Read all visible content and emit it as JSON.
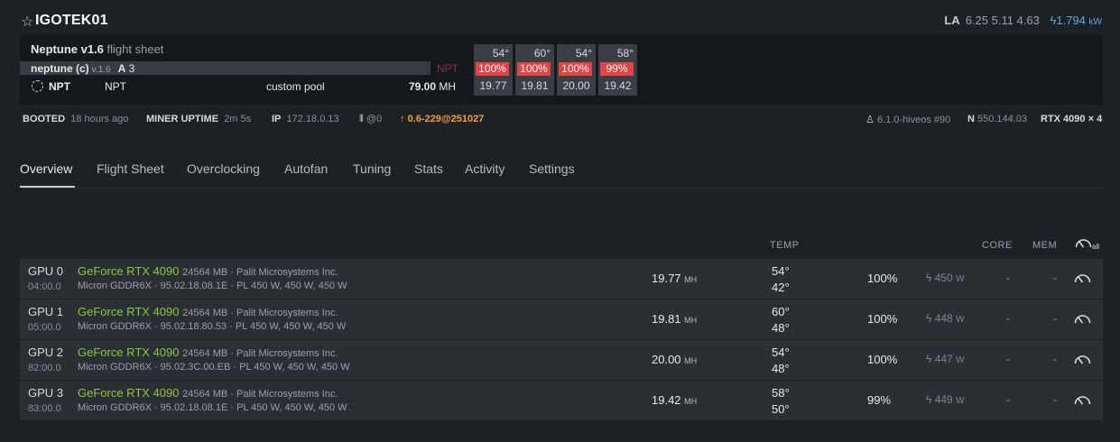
{
  "header": {
    "star_icon": "star-outline-icon",
    "rig_name": "IGOTEK01",
    "la_label": "LA",
    "load_avg": "6.25 5.11 4.63",
    "power_value": "1.794",
    "power_unit": "kW"
  },
  "flight_sheet": {
    "name": "Neptune v1.6",
    "suffix": "flight sheet",
    "miner": "neptune (c)",
    "miner_version": "v.1.6",
    "algo_letter": "A",
    "algo_count": "3",
    "coin_tag": "NPT",
    "coin": "NPT",
    "wallet": "NPT",
    "pool": "custom pool",
    "hashrate": "79.00",
    "hashrate_unit": "MH"
  },
  "gpu_summary": [
    {
      "temp": "54°",
      "fan": "100%",
      "hash": "19.77"
    },
    {
      "temp": "60°",
      "fan": "100%",
      "hash": "19.81"
    },
    {
      "temp": "54°",
      "fan": "100%",
      "hash": "20.00"
    },
    {
      "temp": "58°",
      "fan": "99%",
      "hash": "19.42"
    }
  ],
  "status": {
    "booted_label": "BOOTED",
    "booted_value": "18 hours ago",
    "uptime_label": "MINER UPTIME",
    "uptime_value": "2m 5s",
    "ip_label": "IP",
    "ip_value": "172.18.0.13",
    "network_value": "@0",
    "update_value": "0.6-229@251027",
    "kernel": "6.1.0-hiveos #90",
    "driver_prefix": "N",
    "driver_version": "550.144.03",
    "gpu_model": "RTX 4090",
    "gpu_count": "× 4"
  },
  "tabs": [
    "Overview",
    "Flight Sheet",
    "Overclocking",
    "Autofan",
    "Tuning",
    "Stats",
    "Activity",
    "Settings"
  ],
  "table": {
    "temp_header": "TEMP",
    "core_header": "CORE",
    "mem_header": "MEM",
    "all_label": "all",
    "rows": [
      {
        "idx": "GPU 0",
        "bus": "04:00.0",
        "model": "GeForce RTX 4090",
        "mem": "24564 MB · Palit Microsystems Inc.",
        "details": "Micron GDDR6X · 95.02.18.08.1E · PL 450 W, 450 W, 450 W",
        "hash": "19.77",
        "hash_unit": "MH",
        "temp": "54°",
        "mem_temp": "42°",
        "fan": "100%",
        "power": "450",
        "power_unit": "W",
        "core": "-",
        "mem_oc": "-"
      },
      {
        "idx": "GPU 1",
        "bus": "05:00.0",
        "model": "GeForce RTX 4090",
        "mem": "24564 MB · Palit Microsystems Inc.",
        "details": "Micron GDDR6X · 95.02.18.80.53 · PL 450 W, 450 W, 450 W",
        "hash": "19.81",
        "hash_unit": "MH",
        "temp": "60°",
        "mem_temp": "48°",
        "fan": "100%",
        "power": "448",
        "power_unit": "W",
        "core": "-",
        "mem_oc": "-"
      },
      {
        "idx": "GPU 2",
        "bus": "82:00.0",
        "model": "GeForce RTX 4090",
        "mem": "24564 MB · Palit Microsystems Inc.",
        "details": "Micron GDDR6X · 95.02.3C.00.EB · PL 450 W, 450 W, 450 W",
        "hash": "20.00",
        "hash_unit": "MH",
        "temp": "54°",
        "mem_temp": "48°",
        "fan": "100%",
        "power": "447",
        "power_unit": "W",
        "core": "-",
        "mem_oc": "-"
      },
      {
        "idx": "GPU 3",
        "bus": "83:00.0",
        "model": "GeForce RTX 4090",
        "mem": "24564 MB · Palit Microsystems Inc.",
        "details": "Micron GDDR6X · 95.02.18.08.1E · PL 450 W, 450 W, 450 W",
        "hash": "19.42",
        "hash_unit": "MH",
        "temp": "58°",
        "mem_temp": "50°",
        "fan": "99%",
        "power": "449",
        "power_unit": "W",
        "core": "-",
        "mem_oc": "-"
      }
    ]
  },
  "colors": {
    "background": "#1d2125",
    "panel": "#15181b",
    "row": "#2a2f34",
    "fan_alert": "#e14444",
    "model_green": "#8cc63f",
    "update_orange": "#f0a030",
    "power_blue": "#5aa9e6"
  }
}
